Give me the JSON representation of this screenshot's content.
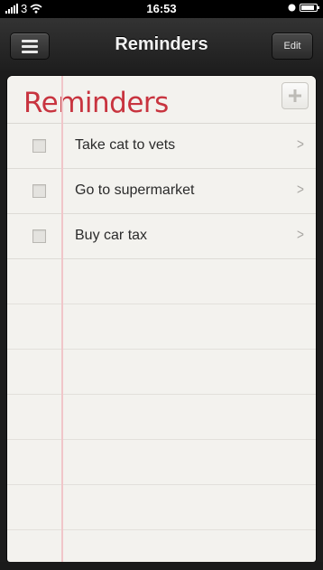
{
  "status_bar": {
    "carrier": "3",
    "time": "16:53",
    "battery_level": 0.85
  },
  "nav": {
    "title": "Reminders",
    "menu_icon": "hamburger-icon",
    "edit_label": "Edit"
  },
  "list": {
    "title": "Reminders",
    "add_icon": "plus-icon",
    "items": [
      {
        "label": "Take cat to vets",
        "checked": false
      },
      {
        "label": "Go to supermarket",
        "checked": false
      },
      {
        "label": "Buy car tax",
        "checked": false
      }
    ]
  },
  "colors": {
    "list_title": "#c8343f",
    "margin_line": "#f0c6c9",
    "paper": "#f3f2ee"
  }
}
